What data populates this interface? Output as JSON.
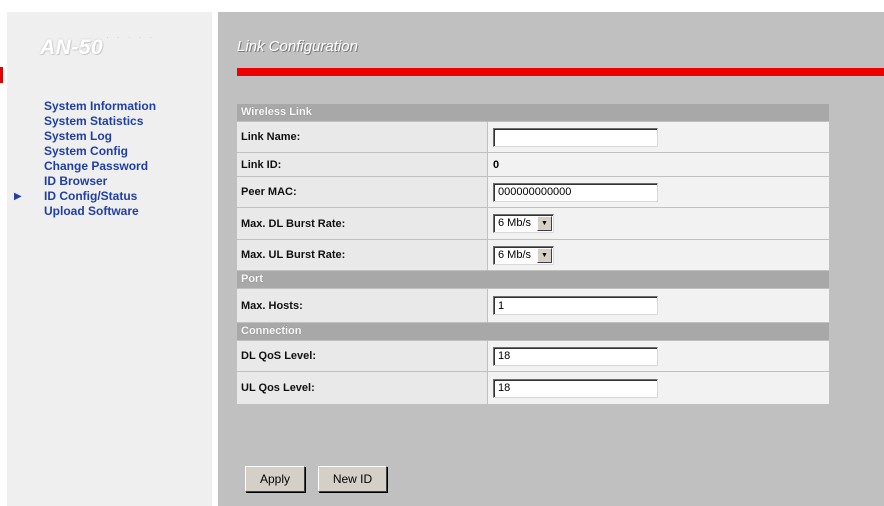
{
  "sidebar": {
    "logo": "AN-50",
    "logo_dots": "· · · · ·",
    "current_marker": "▶",
    "items": [
      {
        "label": "System Information"
      },
      {
        "label": "System Statistics"
      },
      {
        "label": "System Log"
      },
      {
        "label": "System Config"
      },
      {
        "label": "Change Password"
      },
      {
        "label": "ID Browser"
      },
      {
        "label": "ID Config/Status"
      },
      {
        "label": "Upload Software"
      }
    ]
  },
  "main": {
    "title": "Link Configuration"
  },
  "form": {
    "wireless": {
      "header": "Wireless Link",
      "link_name_label": "Link Name:",
      "link_name_value": "",
      "link_id_label": "Link ID:",
      "link_id_value": "0",
      "peer_mac_label": "Peer MAC:",
      "peer_mac_value": "000000000000",
      "dl_burst_label": "Max. DL Burst Rate:",
      "dl_burst_value": "6 Mb/s",
      "ul_burst_label": "Max. UL Burst Rate:",
      "ul_burst_value": "6 Mb/s"
    },
    "port": {
      "header": "Port",
      "max_hosts_label": "Max. Hosts:",
      "max_hosts_value": "1"
    },
    "connection": {
      "header": "Connection",
      "dl_qos_label": "DL QoS Level:",
      "dl_qos_value": "18",
      "ul_qos_label": "UL Qos Level:",
      "ul_qos_value": "18"
    }
  },
  "buttons": {
    "apply": "Apply",
    "new_id": "New ID"
  },
  "colors": {
    "accent_red": "#ee0000",
    "nav_blue": "#1f3fa8",
    "panel_gray": "#c0c0c0"
  }
}
